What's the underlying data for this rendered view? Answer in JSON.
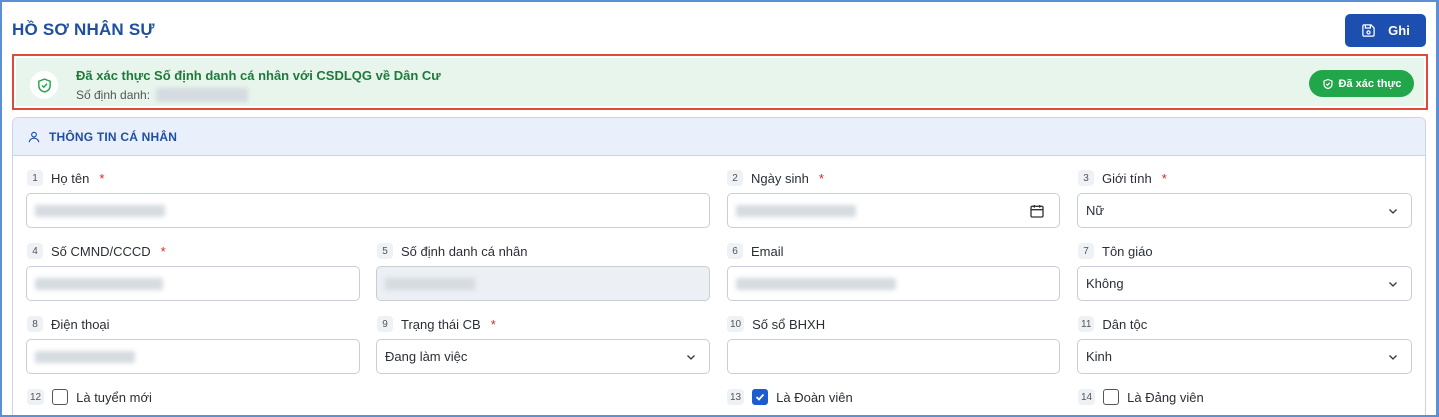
{
  "header": {
    "title": "HỒ SƠ NHÂN SỰ",
    "save_label": "Ghi"
  },
  "verification": {
    "title": "Đã xác thực Số định danh cá nhân với CSDLQG về Dân Cư",
    "id_label": "Số định danh:",
    "badge_label": "Đã xác thực"
  },
  "section": {
    "title": "THÔNG TIN CÁ NHÂN"
  },
  "fields": {
    "f1": {
      "num": "1",
      "label": "Họ tên",
      "required": "*"
    },
    "f2": {
      "num": "2",
      "label": "Ngày sinh",
      "required": "*"
    },
    "f3": {
      "num": "3",
      "label": "Giới tính",
      "required": "*",
      "value": "Nữ"
    },
    "f4": {
      "num": "4",
      "label": "Số CMND/CCCD",
      "required": "*"
    },
    "f5": {
      "num": "5",
      "label": "Số định danh cá nhân"
    },
    "f6": {
      "num": "6",
      "label": "Email"
    },
    "f7": {
      "num": "7",
      "label": "Tôn giáo",
      "value": "Không"
    },
    "f8": {
      "num": "8",
      "label": "Điện thoại"
    },
    "f9": {
      "num": "9",
      "label": "Trạng thái CB",
      "required": "*",
      "value": "Đang làm việc"
    },
    "f10": {
      "num": "10",
      "label": "Số sổ BHXH"
    },
    "f11": {
      "num": "11",
      "label": "Dân tộc",
      "value": "Kinh"
    },
    "f12": {
      "num": "12",
      "label": "Là tuyển mới",
      "checked": false
    },
    "f13": {
      "num": "13",
      "label": "Là Đoàn viên",
      "checked": true
    },
    "f14": {
      "num": "14",
      "label": "Là Đảng viên",
      "checked": false
    }
  },
  "colors": {
    "primary": "#1d4fb0",
    "success": "#22a64a",
    "alert_border": "#e04a3a",
    "required": "#e02424"
  }
}
